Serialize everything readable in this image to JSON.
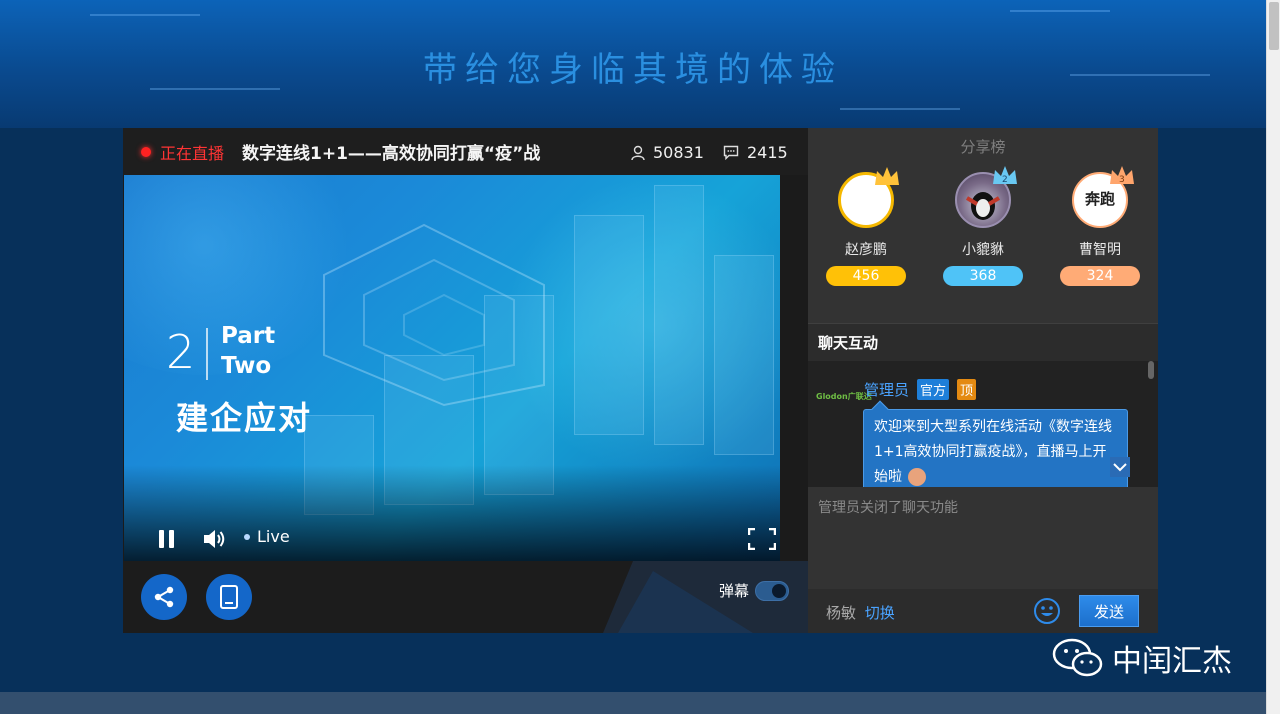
{
  "header": {
    "title": "带给您身临其境的体验"
  },
  "player": {
    "live_status": "正在直播",
    "title": "数字连线1+1——高效协同打赢“疫”战",
    "viewers": "50831",
    "comments": "2415",
    "slide": {
      "number": "2",
      "part_line1": "Part",
      "part_line2": "Two",
      "subtitle": "建企应对"
    },
    "live_indicator": "Live",
    "danmu_label": "弹幕",
    "danmu_on": true
  },
  "leaderboard": {
    "title": "分享榜",
    "entries": [
      {
        "rank": 1,
        "name": "赵彦鹏",
        "score": "456",
        "color": "#ffc107",
        "crown_color": "#ffc23a"
      },
      {
        "rank": 2,
        "name": "小貔貅",
        "score": "368",
        "color": "#4fc3f7",
        "crown_color": "#69c8f2"
      },
      {
        "rank": 3,
        "name": "曹智明",
        "score": "324",
        "color": "#ffab76",
        "crown_color": "#ffa56c"
      }
    ],
    "avatar3_text": "奔跑"
  },
  "chat": {
    "title": "聊天互动",
    "logo_text": "Glodon广联达",
    "message": {
      "user": "管理员",
      "tags": [
        {
          "label": "官方",
          "color": "#1e7fd9"
        },
        {
          "label": "顶",
          "color": "#e48a12"
        }
      ],
      "text": "欢迎来到大型系列在线活动《数字连线1+1高效协同打赢疫战》，直播马上开始啦"
    },
    "disabled_notice": "管理员关闭了聊天功能",
    "current_user": "杨敏",
    "switch_label": "切换",
    "send_label": "发送"
  },
  "watermark": {
    "text": "中闰汇杰"
  }
}
